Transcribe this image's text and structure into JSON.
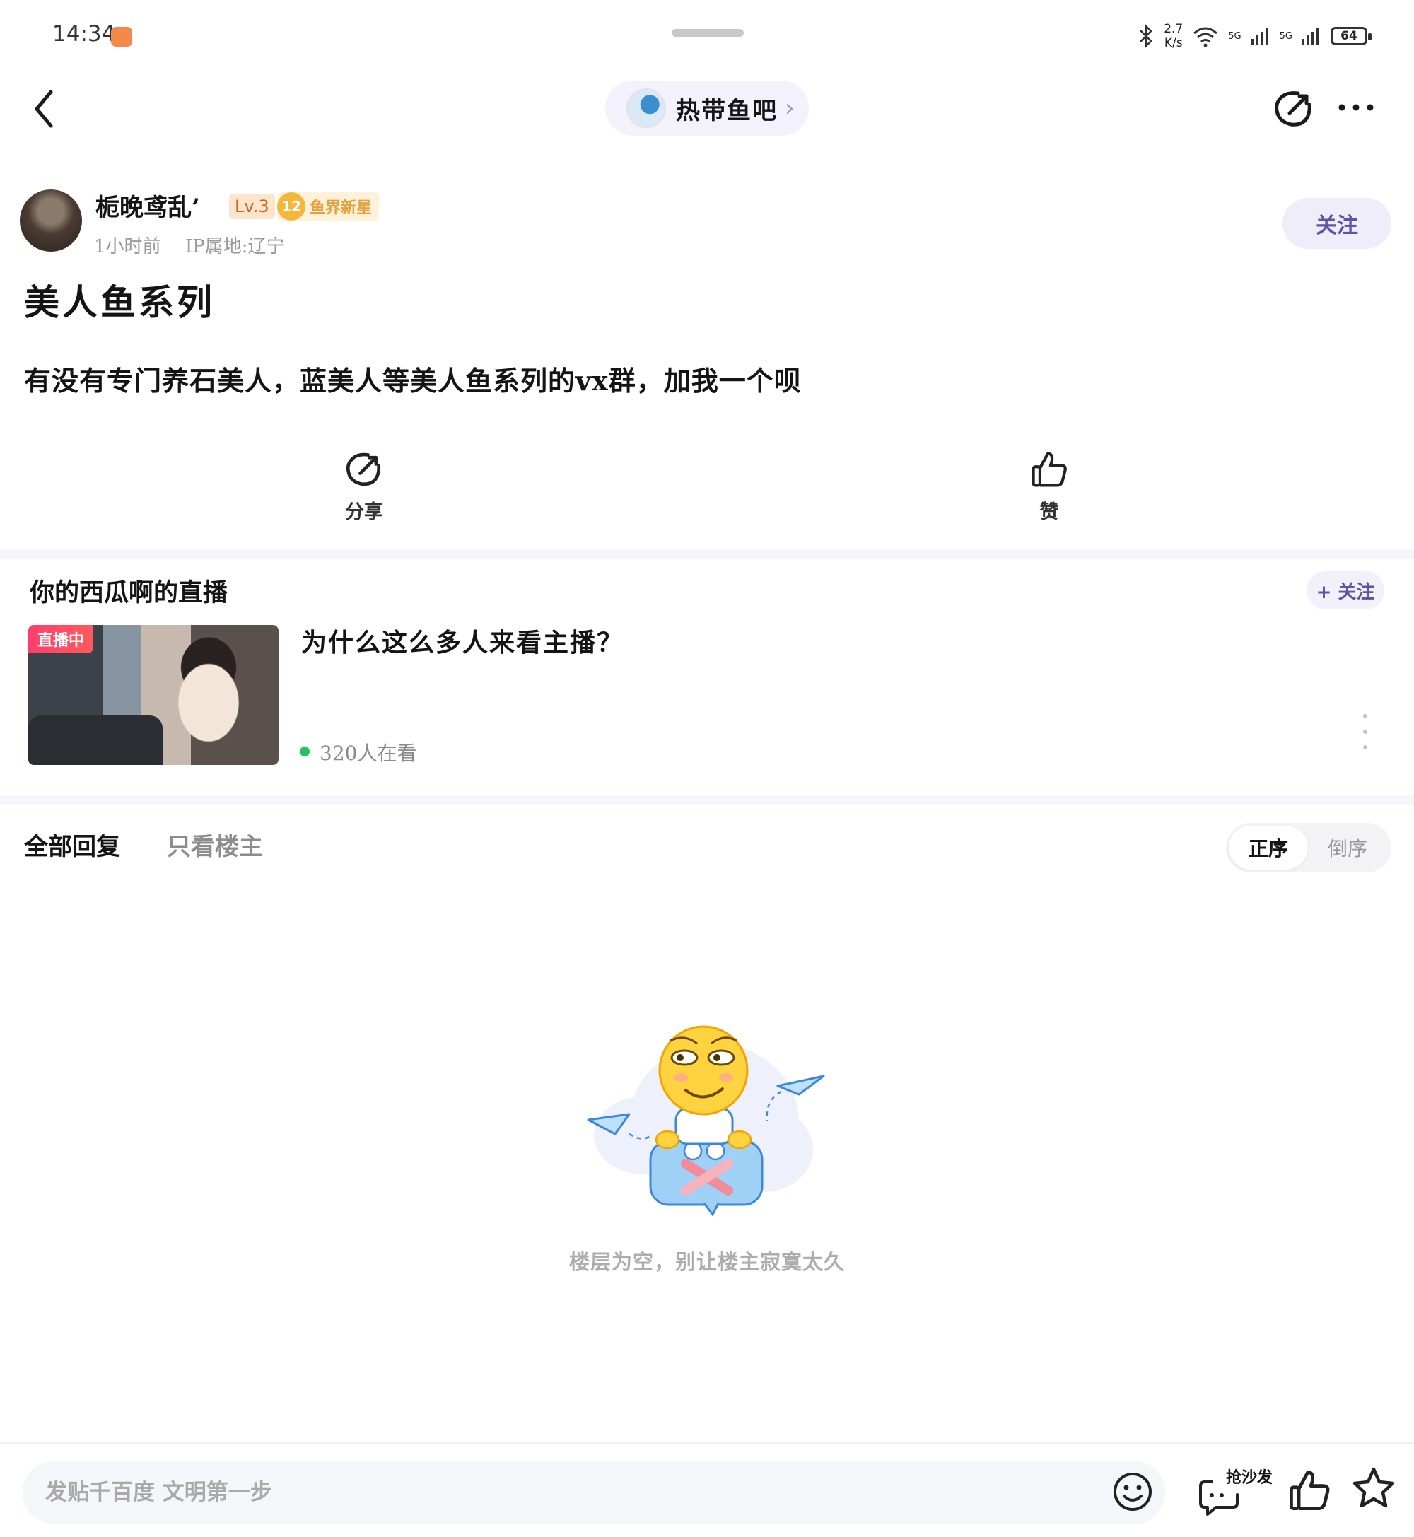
{
  "status_bar": {
    "time": "14:34",
    "net_speed_value": "2.7",
    "net_speed_unit": "K/s",
    "sim1_label": "5G",
    "sim2_label": "5G",
    "battery": "64"
  },
  "header": {
    "forum_name": "热带鱼吧"
  },
  "author": {
    "name": "栀晚鸢乱’",
    "level": "Lv.3",
    "rank_number": "12",
    "rank_title": "鱼界新星",
    "time": "1小时前",
    "ip_location": "IP属地:辽宁",
    "follow_label": "关注"
  },
  "post": {
    "title": "美人鱼系列",
    "body": "有没有专门养石美人，蓝美人等美人鱼系列的vx群，加我一个呗"
  },
  "actions": {
    "share_label": "分享",
    "like_label": "赞"
  },
  "live": {
    "header": "你的西瓜啊的直播",
    "follow_label": "+ 关注",
    "badge": "直播中",
    "title": "为什么这么多人来看主播？",
    "viewers": "320人在看"
  },
  "replies": {
    "tab_all": "全部回复",
    "tab_op_only": "只看楼主",
    "sort_asc": "正序",
    "sort_desc": "倒序",
    "empty_text": "楼层为空，别让楼主寂寞太久"
  },
  "bottom_bar": {
    "input_placeholder": "发贴千百度 文明第一步",
    "sofa_label": "抢沙发"
  },
  "colors": {
    "accent": "#5b55a8",
    "live_badge": "#ff3d6e",
    "online_dot": "#22c55e"
  }
}
